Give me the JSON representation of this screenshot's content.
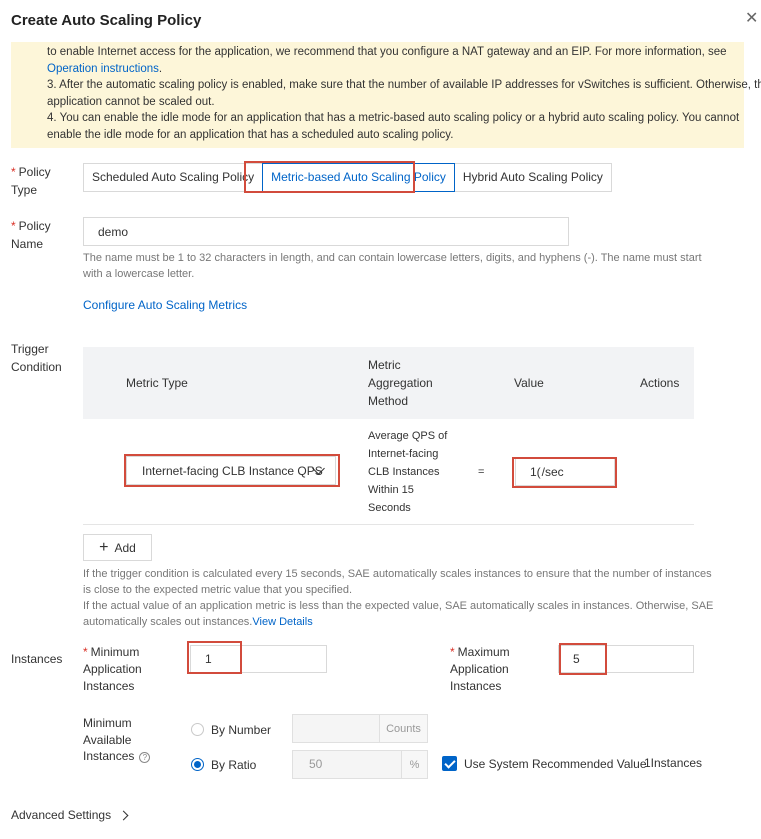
{
  "dialog": {
    "title": "Create Auto Scaling Policy",
    "close_icon": "close-icon"
  },
  "notice": {
    "line1": "to enable Internet access for the application, we recommend that you configure a NAT gateway and an EIP. For more information, see",
    "link": "Operation instructions",
    "link_suffix": ".",
    "line3": "3. After the automatic scaling policy is enabled, make sure that the number of available IP addresses for vSwitches is sufficient. Otherwise, the",
    "line4": "application cannot be scaled out.",
    "line5": "4. You can enable the idle mode for an application that has a metric-based auto scaling policy or a hybrid auto scaling policy. You cannot",
    "line6": "enable the idle mode for an application that has a scheduled auto scaling policy."
  },
  "policy_type": {
    "label_a": "Policy",
    "label_b": "Type",
    "options": [
      "Scheduled Auto Scaling Policy",
      "Metric-based Auto Scaling Policy",
      "Hybrid Auto Scaling Policy"
    ],
    "selected_index": 1
  },
  "policy_name": {
    "label_a": "Policy",
    "label_b": "Name",
    "value": "demo",
    "help1": "The name must be 1 to 32 characters in length, and can contain lowercase letters, digits, and hyphens (-). The name must start",
    "help2": "with a lowercase letter."
  },
  "configure_link": "Configure Auto Scaling Metrics",
  "trigger": {
    "label_a": "Trigger",
    "label_b": "Condition",
    "headers": {
      "metric_type": "Metric Type",
      "agg_1": "Metric",
      "agg_2": "Aggregation",
      "agg_3": "Method",
      "value": "Value",
      "actions": "Actions"
    },
    "row": {
      "metric": "Internet-facing CLB Instance QPS",
      "agg": [
        "Average QPS of",
        "Internet-facing",
        "CLB Instances",
        "Within 15",
        "Seconds"
      ],
      "operator": "=",
      "value": "1(",
      "unit": "/sec"
    },
    "add_label": "Add",
    "help1": "If the trigger condition is calculated every 15 seconds, SAE automatically scales instances to ensure that the number of instances",
    "help2": "is close to the expected metric value that you specified.",
    "help3": "If the actual value of an application metric is less than the expected value, SAE automatically scales in instances. Otherwise, SAE",
    "help4": "automatically scales out instances.",
    "view_details": "View Details"
  },
  "instances": {
    "label": "Instances",
    "min_label": [
      "Minimum",
      "Application",
      "Instances"
    ],
    "min_value": "1",
    "max_label": [
      "Maximum",
      "Application",
      "Instances"
    ],
    "max_value": "5",
    "min_available_label": [
      "Minimum",
      "Available",
      "Instances"
    ],
    "by_number": "By Number",
    "counts_suffix": "Counts",
    "by_ratio": "By Ratio",
    "ratio_value": "50",
    "percent_suffix": "%",
    "use_recommended": "Use System Recommended Value",
    "recommended_count": "1Instances",
    "selected_mode": "By Ratio"
  },
  "advanced_settings": "Advanced Settings"
}
